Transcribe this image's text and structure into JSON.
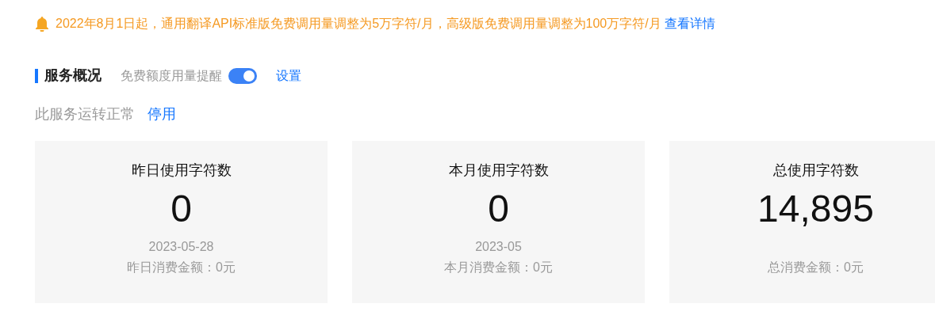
{
  "notice": {
    "text": "2022年8月1日起，通用翻译API标准版免费调用量调整为5万字符/月，高级版免费调用量调整为100万字符/月",
    "link": "查看详情"
  },
  "section": {
    "title": "服务概况",
    "reminder_label": "免费额度用量提醒",
    "reminder_on": true,
    "settings_link": "设置"
  },
  "service_status": {
    "text": "此服务运转正常",
    "action": "停用"
  },
  "stats": [
    {
      "title": "昨日使用字符数",
      "value": "0",
      "date": "2023-05-28",
      "cost": "昨日消费金额：0元"
    },
    {
      "title": "本月使用字符数",
      "value": "0",
      "date": "2023-05",
      "cost": "本月消费金额：0元"
    },
    {
      "title": "总使用字符数",
      "value": "14,895",
      "cost": "总消费金额：0元"
    }
  ]
}
